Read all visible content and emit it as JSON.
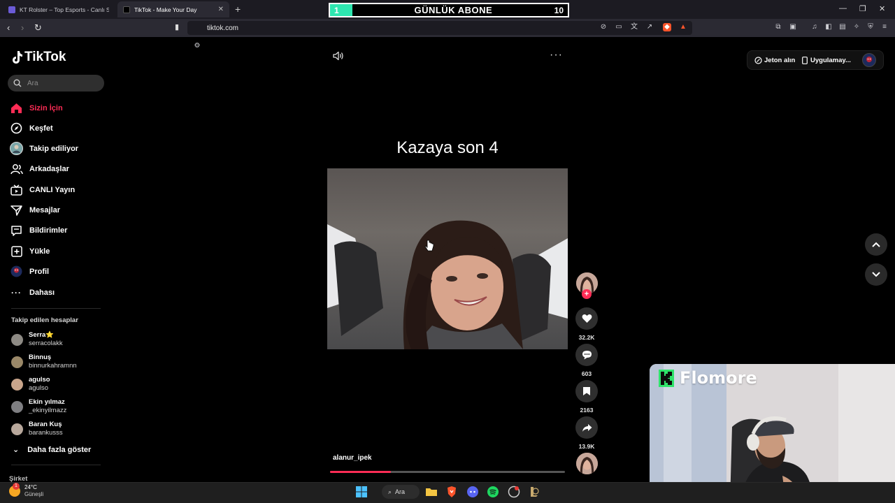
{
  "browser": {
    "tabs": [
      {
        "label": "KT Rolster – Top Esports - Canlı Sonu"
      },
      {
        "label": "TikTok - Make Your Day"
      }
    ],
    "url": "tiktok.com"
  },
  "subscriber_overlay": {
    "left_value": "1",
    "label": "GÜNLÜK ABONE",
    "right_value": "10"
  },
  "tiktok": {
    "logo": "TikTok",
    "search_placeholder": "Ara",
    "nav": [
      {
        "label": "Sizin İçin",
        "icon": "home-icon",
        "active": true
      },
      {
        "label": "Keşfet",
        "icon": "compass-icon"
      },
      {
        "label": "Takip ediliyor",
        "icon": "following-avatar-icon"
      },
      {
        "label": "Arkadaşlar",
        "icon": "friends-icon"
      },
      {
        "label": "CANLI Yayın",
        "icon": "live-icon"
      },
      {
        "label": "Mesajlar",
        "icon": "messages-icon"
      },
      {
        "label": "Bildirimler",
        "icon": "notifications-icon"
      },
      {
        "label": "Yükle",
        "icon": "upload-icon"
      },
      {
        "label": "Profil",
        "icon": "profile-icon"
      },
      {
        "label": "Dahası",
        "icon": "more-icon"
      }
    ],
    "followed_section_title": "Takip edilen hesaplar",
    "followed_accounts": [
      {
        "name": "Serra⭐",
        "username": "serracolakk"
      },
      {
        "name": "Binnuş",
        "username": "binnurkahramnn"
      },
      {
        "name": "agulso",
        "username": "agulso"
      },
      {
        "name": "Ekin yılmaz",
        "username": "_ekinyilmazz"
      },
      {
        "name": "Baran Kuş",
        "username": "barankusss"
      }
    ],
    "show_more": "Daha fazla göster",
    "company": "Şirket",
    "top_right": {
      "coins": "Jeton alın",
      "app": "Uygulamay..."
    },
    "video": {
      "title": "Kazaya son 4",
      "author": "alanur_ipek",
      "progress": 0.26,
      "likes": "32.2K",
      "comments": "603",
      "saves": "2163",
      "shares": "13.9K"
    }
  },
  "webcam": {
    "brand": "Flomore"
  },
  "taskbar": {
    "temperature": "24°C",
    "condition": "Güneşli",
    "search": "Ara",
    "notification_count": "1"
  },
  "colors": {
    "accent": "#fe2c55",
    "overlay_green": "#2ee6b0",
    "cam_green": "#2fe36b"
  }
}
